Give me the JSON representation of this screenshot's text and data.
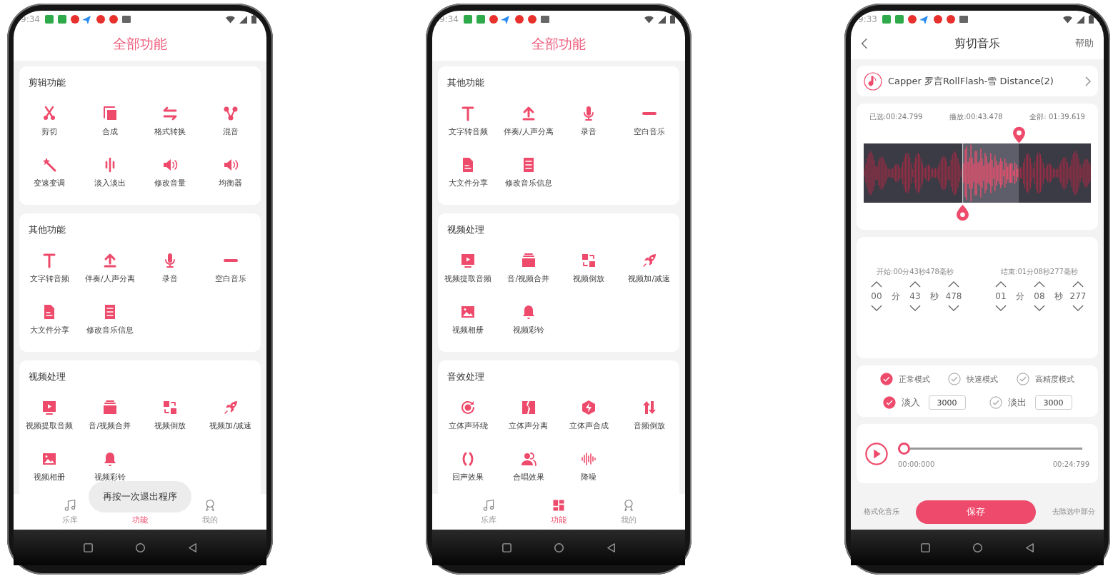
{
  "phones": [
    {
      "kind": "functions",
      "status_bar": {
        "time": "9:34"
      },
      "title": "全部功能",
      "sections": [
        {
          "title": "剪辑功能",
          "items": [
            "剪切",
            "合成",
            "格式转换",
            "混音",
            "变速变调",
            "淡入淡出",
            "修改音量",
            "均衡器"
          ]
        },
        {
          "title": "其他功能",
          "items": [
            "文字转音频",
            "伴奏/人声分离",
            "录音",
            "空白音乐",
            "大文件分享",
            "修改音乐信息"
          ]
        },
        {
          "title": "视频处理",
          "items": [
            "视频提取音频",
            "音/视频合并",
            "视频倒放",
            "视频加/减速",
            "视频相册",
            "视频彩铃"
          ]
        }
      ],
      "toast": "再按一次退出程序",
      "tabs": [
        {
          "label": "乐库",
          "selected": false
        },
        {
          "label": "功能",
          "selected": true
        },
        {
          "label": "我的",
          "selected": false
        }
      ]
    },
    {
      "kind": "functions",
      "status_bar": {
        "time": "9:34"
      },
      "title": "全部功能",
      "sections": [
        {
          "title": "其他功能",
          "items": [
            "文字转音频",
            "伴奏/人声分离",
            "录音",
            "空白音乐",
            "大文件分享",
            "修改音乐信息"
          ]
        },
        {
          "title": "视频处理",
          "items": [
            "视频提取音频",
            "音/视频合并",
            "视频倒放",
            "视频加/减速",
            "视频相册",
            "视频彩铃"
          ]
        },
        {
          "title": "音效处理",
          "items": [
            "立体声环绕",
            "立体声分离",
            "立体声合成",
            "音频倒放",
            "回声效果",
            "合唱效果",
            "降噪"
          ]
        }
      ],
      "tabs": [
        {
          "label": "乐库",
          "selected": false
        },
        {
          "label": "功能",
          "selected": true
        },
        {
          "label": "我的",
          "selected": false
        }
      ]
    },
    {
      "kind": "editor",
      "status_bar": {
        "time": "9:33"
      },
      "header": {
        "title": "剪切音乐",
        "action": "帮助"
      },
      "song": {
        "title": "Capper 罗言RollFlash-雪 Distance(2)"
      },
      "stats": [
        "已选:00:24.799",
        "播放:00:43.478",
        "全部: 01:39.619"
      ],
      "pickers": [
        {
          "label": "开始:00分43秒478毫秒",
          "fields": [
            {
              "value": "00",
              "unit": "分"
            },
            {
              "value": "43",
              "unit": "秒"
            },
            {
              "value": "478"
            }
          ]
        },
        {
          "label": "结束:01分08秒277毫秒",
          "fields": [
            {
              "value": "01",
              "unit": "分"
            },
            {
              "value": "08",
              "unit": "秒"
            },
            {
              "value": "277"
            }
          ]
        }
      ],
      "modes": [
        {
          "label": "正常模式",
          "selected": true
        },
        {
          "label": "快速模式",
          "selected": false
        },
        {
          "label": "高精度模式",
          "selected": false
        }
      ],
      "fades": [
        {
          "label": "淡入",
          "checked": true,
          "value": "3000"
        },
        {
          "label": "淡出",
          "checked": false,
          "value": "3000"
        }
      ],
      "player": {
        "level": 0,
        "current": "00:00:000",
        "total": "00:24:799"
      },
      "actions": {
        "left": "格式化音乐",
        "primary": "保存",
        "right": "去除选中部分"
      }
    }
  ]
}
